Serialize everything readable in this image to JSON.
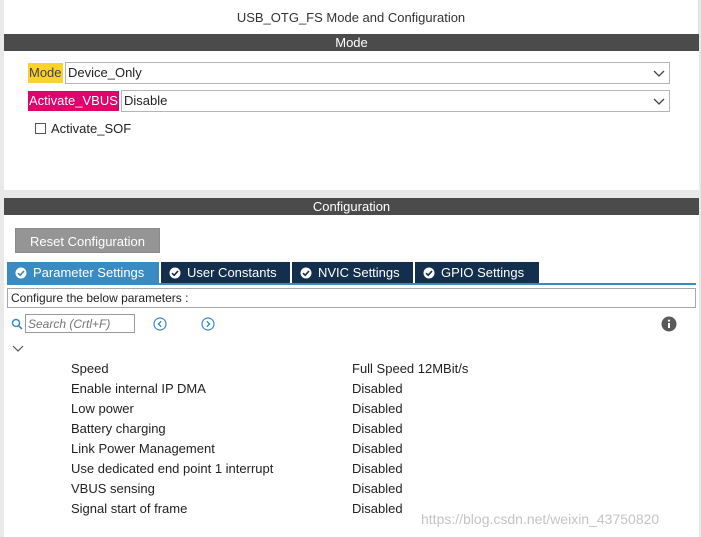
{
  "window": {
    "title": "USB_OTG_FS Mode and Configuration"
  },
  "mode_section": {
    "header": "Mode",
    "mode": {
      "label": "Mode",
      "value": "Device_Only"
    },
    "activate_vbus": {
      "label": "Activate_VBUS",
      "value": "Disable"
    },
    "activate_sof": {
      "label": "Activate_SOF",
      "checked": false
    }
  },
  "config_section": {
    "header": "Configuration",
    "reset_button": "Reset Configuration",
    "tabs": [
      {
        "label": "Parameter Settings",
        "active": true,
        "icon": "check-circle-icon"
      },
      {
        "label": "User Constants",
        "active": false,
        "icon": "check-circle-icon"
      },
      {
        "label": "NVIC Settings",
        "active": false,
        "icon": "check-circle-icon"
      },
      {
        "label": "GPIO Settings",
        "active": false,
        "icon": "check-circle-icon"
      }
    ],
    "params_header": "Configure the below parameters :",
    "search": {
      "placeholder": "Search (Crtl+F)"
    },
    "parameters": [
      {
        "name": "Speed",
        "value": "Full Speed 12MBit/s"
      },
      {
        "name": "Enable internal IP DMA",
        "value": "Disabled"
      },
      {
        "name": "Low power",
        "value": "Disabled"
      },
      {
        "name": "Battery charging",
        "value": "Disabled"
      },
      {
        "name": "Link Power Management",
        "value": "Disabled"
      },
      {
        "name": "Use dedicated end point 1 interrupt",
        "value": "Disabled"
      },
      {
        "name": "VBUS sensing",
        "value": "Disabled"
      },
      {
        "name": "Signal start of frame",
        "value": "Disabled"
      }
    ]
  },
  "watermark": "https://blog.csdn.net/weixin_43750820",
  "colors": {
    "section_bar": "#4b4b4b",
    "mode_label_bg": "#f9d22e",
    "vbus_label_bg": "#e4006b",
    "tab_active": "#3b8bc3",
    "tab_inactive": "#142f4d",
    "reset_button": "#959595"
  }
}
